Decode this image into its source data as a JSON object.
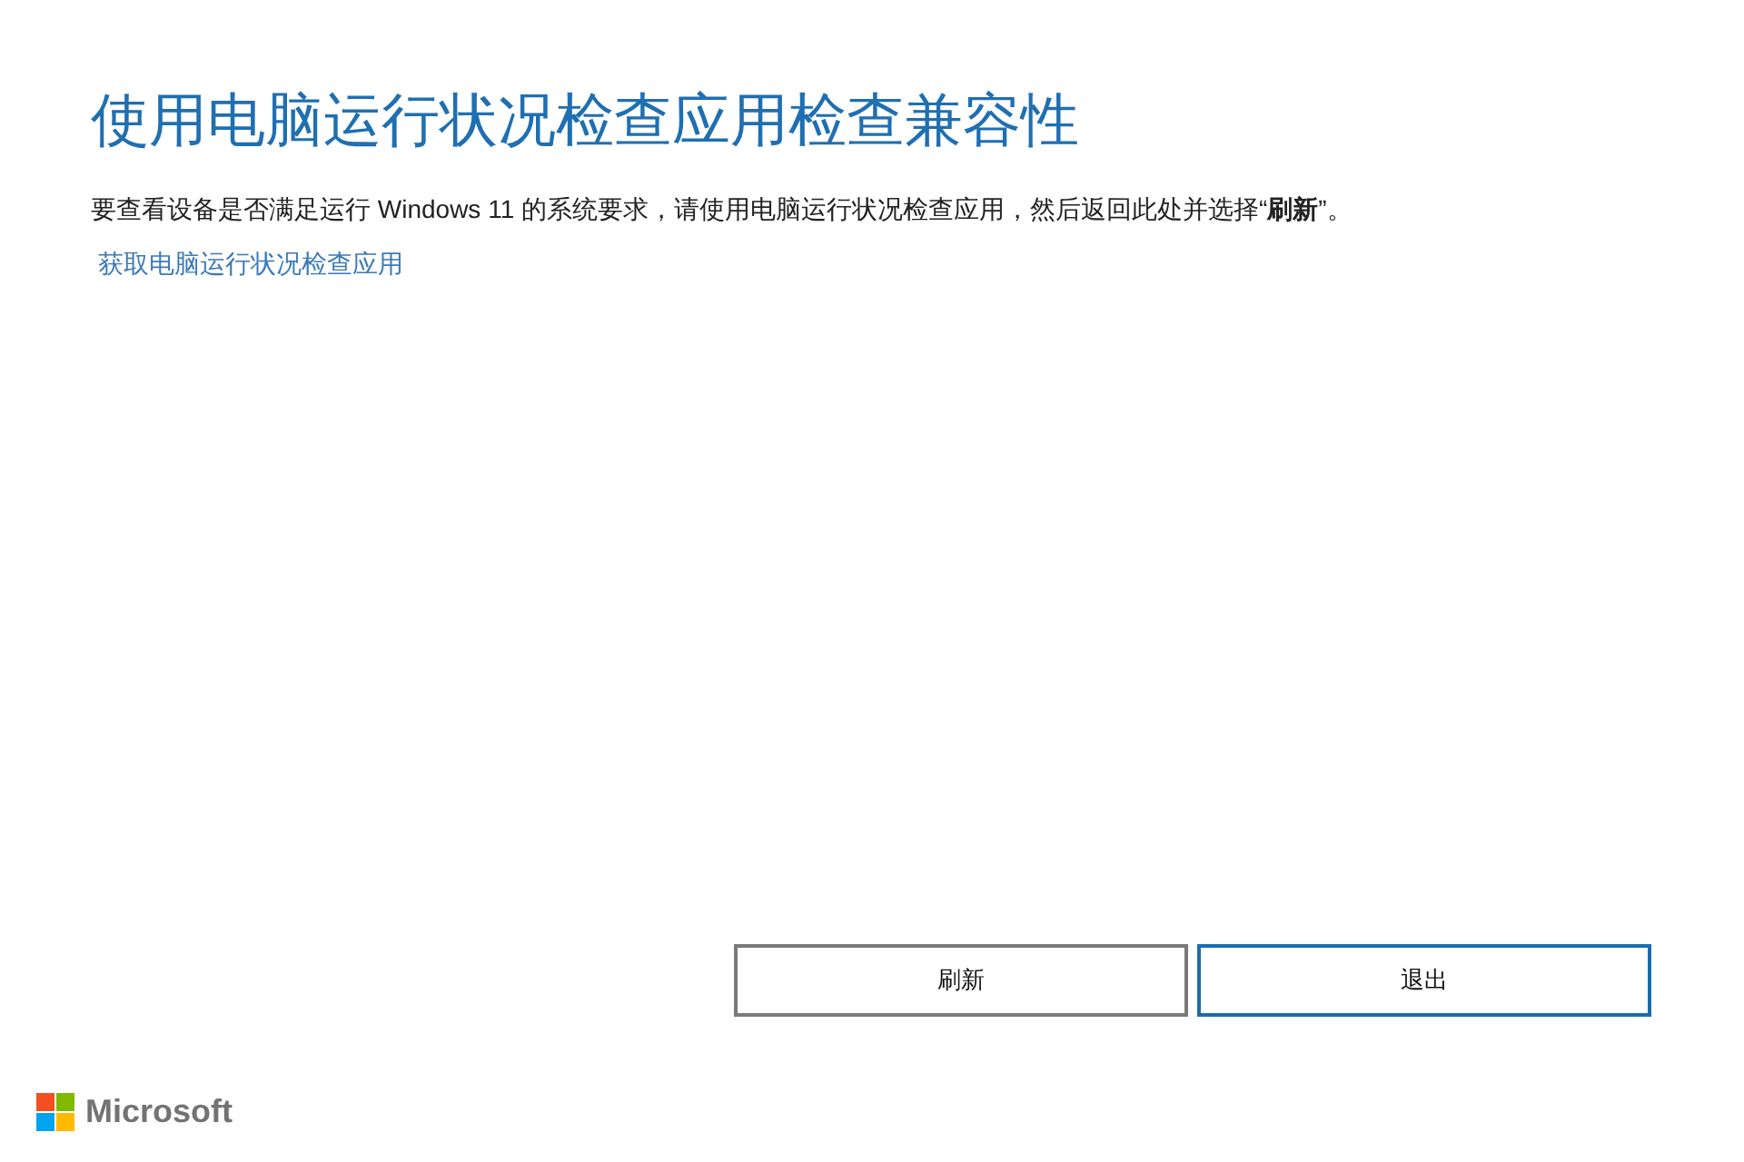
{
  "title": "使用电脑运行状况检查应用检查兼容性",
  "description": {
    "text": "要查看设备是否满足运行 Windows 11 的系统要求，请使用电脑运行状况检查应用，然后返回此处并选择“**刷新**”。",
    "link": "获取电脑运行状况检查应用"
  },
  "buttons": [
    {
      "label": "刷新",
      "focused": false
    },
    {
      "label": "退出",
      "focused": true
    }
  ],
  "footer": {
    "brand": "Microsoft"
  }
}
